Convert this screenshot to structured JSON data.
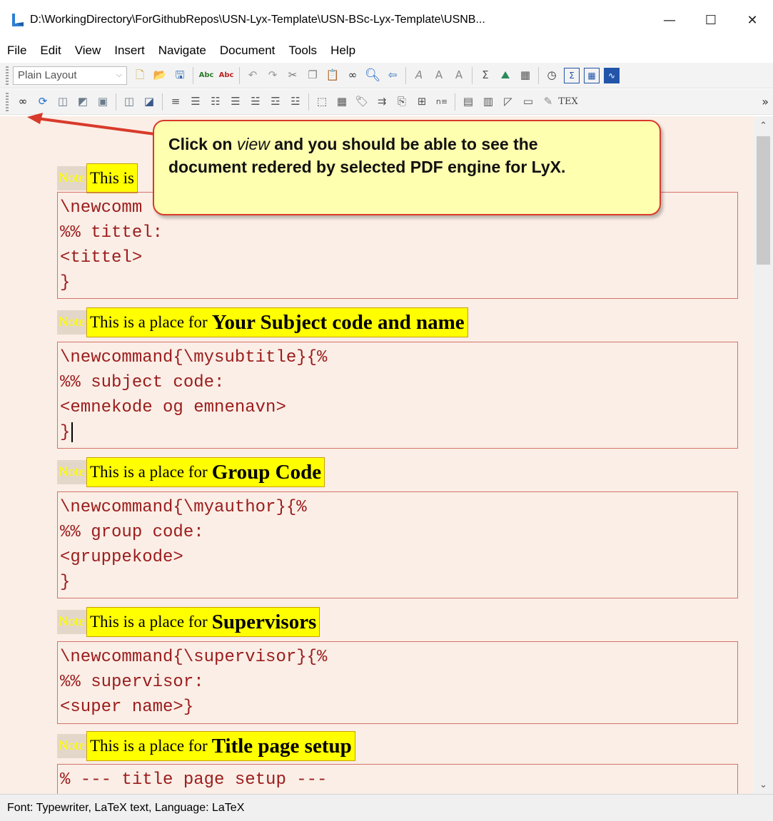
{
  "window": {
    "title": "D:\\WorkingDirectory\\ForGithubRepos\\USN-Lyx-Template\\USN-BSc-Lyx-Template\\USNB...",
    "minimize_glyph": "—",
    "maximize_glyph": "☐",
    "close_glyph": "✕"
  },
  "menu": [
    "File",
    "Edit",
    "View",
    "Insert",
    "Navigate",
    "Document",
    "Tools",
    "Help"
  ],
  "toolbar": {
    "layout_value": "Plain Layout",
    "overflow": "»",
    "row1_icons": [
      "new-document-icon",
      "open-folder-icon",
      "save-icon",
      "spellcheck-icon",
      "spellcheck-continuous-icon",
      "undo-icon",
      "redo-icon",
      "cut-icon",
      "copy-icon",
      "paste-icon",
      "find-replace-icon",
      "find-icon",
      "navigate-back-icon",
      "text-style-icon",
      "text-emphasis-icon",
      "text-noun-icon",
      "math-sum-icon",
      "insert-figure-icon",
      "insert-table-icon",
      "navigator-icon",
      "math-mode-icon",
      "math-matrix-icon",
      "math-macro-icon"
    ],
    "row2_icons": [
      "view-icon",
      "update-icon",
      "view-master-icon",
      "update-master-icon",
      "refresh-icon",
      "view-other-icon",
      "update-other-icon",
      "align-icon",
      "list-bullet-icon",
      "list-number-icon",
      "list-description-icon",
      "list-indent-icon",
      "list-outdent-icon",
      "insert-graphics-icon",
      "insert-table-2-icon",
      "insert-label-icon",
      "insert-reference-icon",
      "insert-citation-icon",
      "insert-index-icon",
      "insert-nomenclature-icon",
      "paragraph-icon",
      "paragraph-settings-icon",
      "note-icon",
      "text-box-icon",
      "tex-code-icon",
      "tex-icon"
    ]
  },
  "callout": {
    "line1_pre": "Click on ",
    "line1_em": "view",
    "line1_post": " and you should be able to see the",
    "line2": "document redered by selected PDF engine for LyX."
  },
  "notes": [
    {
      "tag": "Note",
      "prefix": "This is a place for",
      "bold": "Your Subject code and name"
    },
    {
      "tag": "Note",
      "prefix": "This is a place for",
      "bold": "Group Code"
    },
    {
      "tag": "Note",
      "prefix": "This is a place for",
      "bold": "Supervisors"
    },
    {
      "tag": "Note",
      "prefix": "This is a place for",
      "bold": "Title page setup"
    }
  ],
  "first_note": {
    "tag": "Note",
    "prefix": "This is"
  },
  "code_blocks": [
    [
      "\\newcomm",
      "%% tittel:",
      "<tittel>",
      "}"
    ],
    [
      "\\newcommand{\\mysubtitle}{%",
      "%% subject code:",
      "<emnekode og emnenavn>",
      "}"
    ],
    [
      "\\newcommand{\\myauthor}{%",
      "%% group code:",
      "<gruppekode>",
      "}"
    ],
    [
      "\\newcommand{\\supervisor}{%",
      "%% supervisor:",
      "<super name>}"
    ],
    [
      "% --- title page setup ---"
    ]
  ],
  "status": "Font: Typewriter, LaTeX text, Language: LaTeX",
  "colors": {
    "doc_bg": "#faeee6",
    "note_highlight": "#ffff00",
    "code_text": "#9b1c1c",
    "callout_border": "#d83a2a"
  }
}
